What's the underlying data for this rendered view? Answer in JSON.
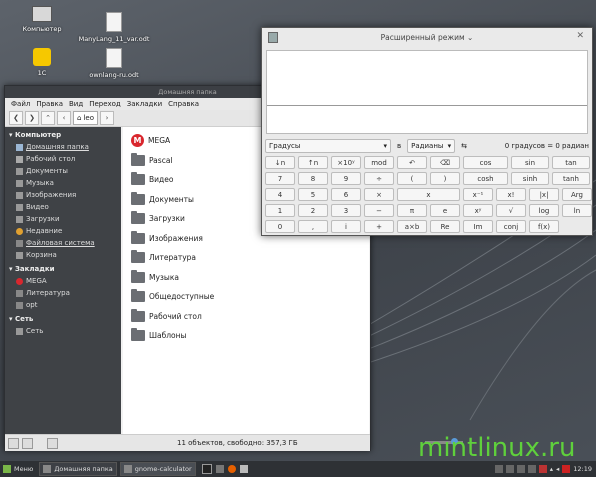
{
  "desktop": {
    "icons": [
      {
        "label": "Компьютер"
      },
      {
        "label": "ManyLang_11_var.odt"
      },
      {
        "label": "1С"
      },
      {
        "label": "ownlang-ru.odt"
      }
    ]
  },
  "file_manager": {
    "title": "Домашняя папка",
    "menu": [
      "Файл",
      "Правка",
      "Вид",
      "Переход",
      "Закладки",
      "Справка"
    ],
    "path": "leo",
    "sidebar": {
      "computer_head": "Компьютер",
      "computer_items": [
        "Домашняя папка",
        "Рабочий стол",
        "Документы",
        "Музыка",
        "Изображения",
        "Видео",
        "Загрузки",
        "Недавние",
        "Файловая система",
        "Корзина"
      ],
      "bookmarks_head": "Закладки",
      "bookmarks_items": [
        "MEGA",
        "Литература",
        "opt"
      ],
      "network_head": "Сеть",
      "network_items": [
        "Сеть"
      ]
    },
    "files": [
      "MEGA",
      "Pascal",
      "Видео",
      "Документы",
      "Загрузки",
      "Изображения",
      "Литература",
      "Музыка",
      "Общедоступные",
      "Рабочий стол",
      "Шаблоны"
    ],
    "status": "11 объектов, свободно: 357,3 ГБ"
  },
  "calculator": {
    "title": "Расширенный режим",
    "angle_unit": "Градусы",
    "conv_label": "в",
    "target_unit": "Радианы",
    "swap_icon": "⇆",
    "conversion": "0 градусов = 0 радиан",
    "rows": [
      [
        "↓n",
        "↑n",
        "×10ʸ",
        "mod",
        "↶",
        "⌫",
        "cos",
        "sin",
        "tan"
      ],
      [
        "7",
        "8",
        "9",
        "÷",
        "(",
        ")",
        "cosh",
        "sinh",
        "tanh"
      ],
      [
        "4",
        "5",
        "6",
        "×",
        "x",
        "x⁻¹",
        "x!",
        "|x|",
        "Arg"
      ],
      [
        "1",
        "2",
        "3",
        "−",
        "π",
        "e",
        "xʸ",
        "√",
        "log",
        "ln"
      ],
      [
        "0",
        ",",
        "i",
        "+",
        "a×b",
        "Re",
        "Im",
        "conj",
        "f(x)"
      ]
    ]
  },
  "panel": {
    "menu": "Меню",
    "windows": [
      "Домашняя папка",
      "gnome-calculator"
    ],
    "clock": "12:19"
  },
  "watermark": "mintlinux.ru"
}
